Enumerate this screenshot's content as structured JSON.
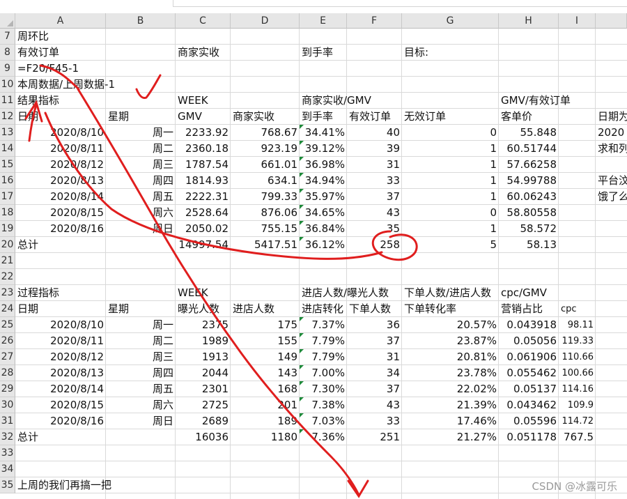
{
  "columns": [
    "A",
    "B",
    "C",
    "D",
    "E",
    "F",
    "G",
    "H",
    "I"
  ],
  "rows": [
    "7",
    "8",
    "9",
    "10",
    "11",
    "12",
    "13",
    "14",
    "15",
    "16",
    "17",
    "18",
    "19",
    "20",
    "21",
    "22",
    "23",
    "24",
    "25",
    "26",
    "27",
    "28",
    "29",
    "30",
    "31",
    "32",
    "33",
    "34",
    "35"
  ],
  "cells": {
    "r7": {
      "A": "周环比"
    },
    "r8": {
      "A": "有效订单",
      "C": "商家实收",
      "E": "到手率",
      "G": "目标:"
    },
    "r9": {
      "A": "=F20/F45-1"
    },
    "r10": {
      "A": "本周数据/上周数据-1"
    },
    "r11": {
      "A": "结果指标",
      "C": "WEEK",
      "E": "商家实收/GMV",
      "H": "GMV/有效订单"
    },
    "r12": {
      "A": "日期",
      "B": "星期",
      "C": "GMV",
      "D": "商家实收",
      "E": "到手率",
      "F": "有效订单",
      "G": "无效订单",
      "H": "客单价",
      "J": "日期为"
    },
    "r13": {
      "A": "2020/8/10",
      "B": "周一",
      "C": "2233.92",
      "D": "768.67",
      "E": "34.41%",
      "F": "40",
      "G": "0",
      "H": "55.848",
      "J": "2020"
    },
    "r14": {
      "A": "2020/8/11",
      "B": "周二",
      "C": "2360.18",
      "D": "923.19",
      "E": "39.12%",
      "F": "39",
      "G": "1",
      "H": "60.51744",
      "J": "求和列"
    },
    "r15": {
      "A": "2020/8/12",
      "B": "周三",
      "C": "1787.54",
      "D": "661.01",
      "E": "36.98%",
      "F": "31",
      "G": "1",
      "H": "57.66258"
    },
    "r16": {
      "A": "2020/8/13",
      "B": "周四",
      "C": "1814.93",
      "D": "634.1",
      "E": "34.94%",
      "F": "33",
      "G": "1",
      "H": "54.99788",
      "J": "平台汶"
    },
    "r17": {
      "A": "2020/8/14",
      "B": "周五",
      "C": "2222.31",
      "D": "799.33",
      "E": "35.97%",
      "F": "37",
      "G": "1",
      "H": "60.06243",
      "J": "饿了么"
    },
    "r18": {
      "A": "2020/8/15",
      "B": "周六",
      "C": "2528.64",
      "D": "876.06",
      "E": "34.65%",
      "F": "43",
      "G": "0",
      "H": "58.80558"
    },
    "r19": {
      "A": "2020/8/16",
      "B": "周日",
      "C": "2050.02",
      "D": "755.15",
      "E": "36.84%",
      "F": "35",
      "G": "1",
      "H": "58.572"
    },
    "r20": {
      "A": "总计",
      "C": "14997.54",
      "D": "5417.51",
      "E": "36.12%",
      "F": "258",
      "G": "5",
      "H": "58.13"
    },
    "r23": {
      "A": "过程指标",
      "C": "WEEK",
      "E": "进店人数/曝光人数",
      "G": "下单人数/进店人数",
      "H": "cpc/GMV"
    },
    "r24": {
      "A": "日期",
      "B": "星期",
      "C": "曝光人数",
      "D": "进店人数",
      "E": "进店转化",
      "F": "下单人数",
      "G": "下单转化率",
      "H": "营销占比",
      "I": "cpc"
    },
    "r25": {
      "A": "2020/8/10",
      "B": "周一",
      "C": "2375",
      "D": "175",
      "E": "7.37%",
      "F": "36",
      "G": "20.57%",
      "H": "0.043918",
      "I": "98.11"
    },
    "r26": {
      "A": "2020/8/11",
      "B": "周二",
      "C": "1989",
      "D": "155",
      "E": "7.79%",
      "F": "37",
      "G": "23.87%",
      "H": "0.05056",
      "I": "119.33"
    },
    "r27": {
      "A": "2020/8/12",
      "B": "周三",
      "C": "1913",
      "D": "149",
      "E": "7.79%",
      "F": "31",
      "G": "20.81%",
      "H": "0.061906",
      "I": "110.66"
    },
    "r28": {
      "A": "2020/8/13",
      "B": "周四",
      "C": "2044",
      "D": "143",
      "E": "7.00%",
      "F": "34",
      "G": "23.78%",
      "H": "0.055462",
      "I": "100.66"
    },
    "r29": {
      "A": "2020/8/14",
      "B": "周五",
      "C": "2301",
      "D": "168",
      "E": "7.30%",
      "F": "37",
      "G": "22.02%",
      "H": "0.05137",
      "I": "114.16"
    },
    "r30": {
      "A": "2020/8/15",
      "B": "周六",
      "C": "2725",
      "D": "201",
      "E": "7.38%",
      "F": "43",
      "G": "21.39%",
      "H": "0.043462",
      "I": "109.9"
    },
    "r31": {
      "A": "2020/8/16",
      "B": "周日",
      "C": "2689",
      "D": "189",
      "E": "7.03%",
      "F": "33",
      "G": "17.46%",
      "H": "0.05596",
      "I": "114.72"
    },
    "r32": {
      "A": "总计",
      "C": "16036",
      "D": "1180",
      "E": "7.36%",
      "F": "251",
      "G": "21.27%",
      "H": "0.051178",
      "I": "767.5"
    },
    "r35": {
      "A": "上周的我们再搞一把"
    }
  },
  "watermark": "CSDN @冰露可乐",
  "colors": {
    "header_bg": "#e6e6e6",
    "grid_line": "#d9d9d9",
    "annotation_red": "#e01e1e",
    "error_triangle": "#1e8a3a"
  }
}
